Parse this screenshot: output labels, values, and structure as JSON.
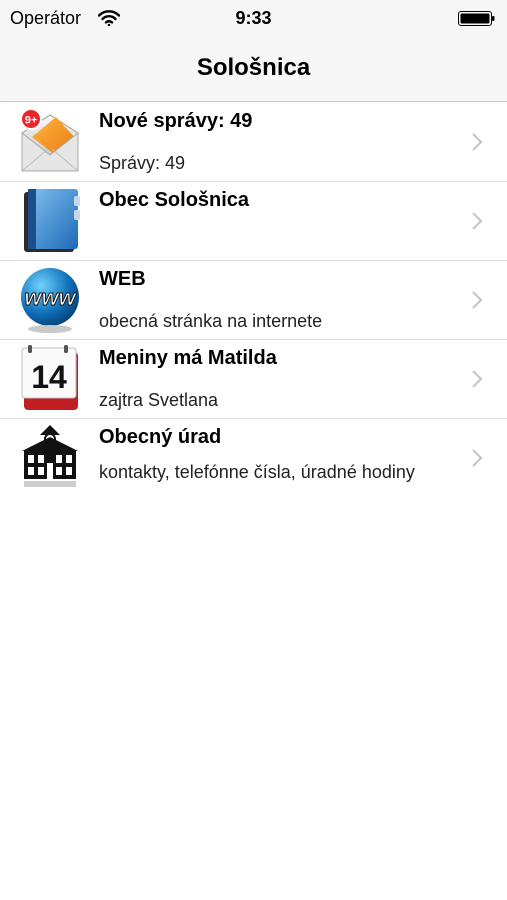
{
  "status_bar": {
    "carrier": "Operátor",
    "time": "9:33"
  },
  "nav": {
    "title": "Sološnica"
  },
  "items": [
    {
      "title": "Nové správy: 49",
      "subtitle": "Správy: 49",
      "icon": "mail-icon",
      "badge": "9+"
    },
    {
      "title": "Obec Sološnica",
      "subtitle": "",
      "icon": "book-icon"
    },
    {
      "title": "WEB",
      "subtitle": "obecná stránka na internete",
      "icon": "globe-icon",
      "icon_text": "www"
    },
    {
      "title": "Meniny má Matilda",
      "subtitle": "zajtra Svetlana",
      "icon": "calendar-icon",
      "icon_text": "14"
    },
    {
      "title": "Obecný úrad",
      "subtitle": "kontakty, telefónne čísla, úradné hodiny",
      "icon": "town-hall-icon"
    }
  ],
  "colors": {
    "bar_background": "#f7f7f7",
    "separator": "#e1e1e3",
    "chevron": "#c7c7cc"
  }
}
